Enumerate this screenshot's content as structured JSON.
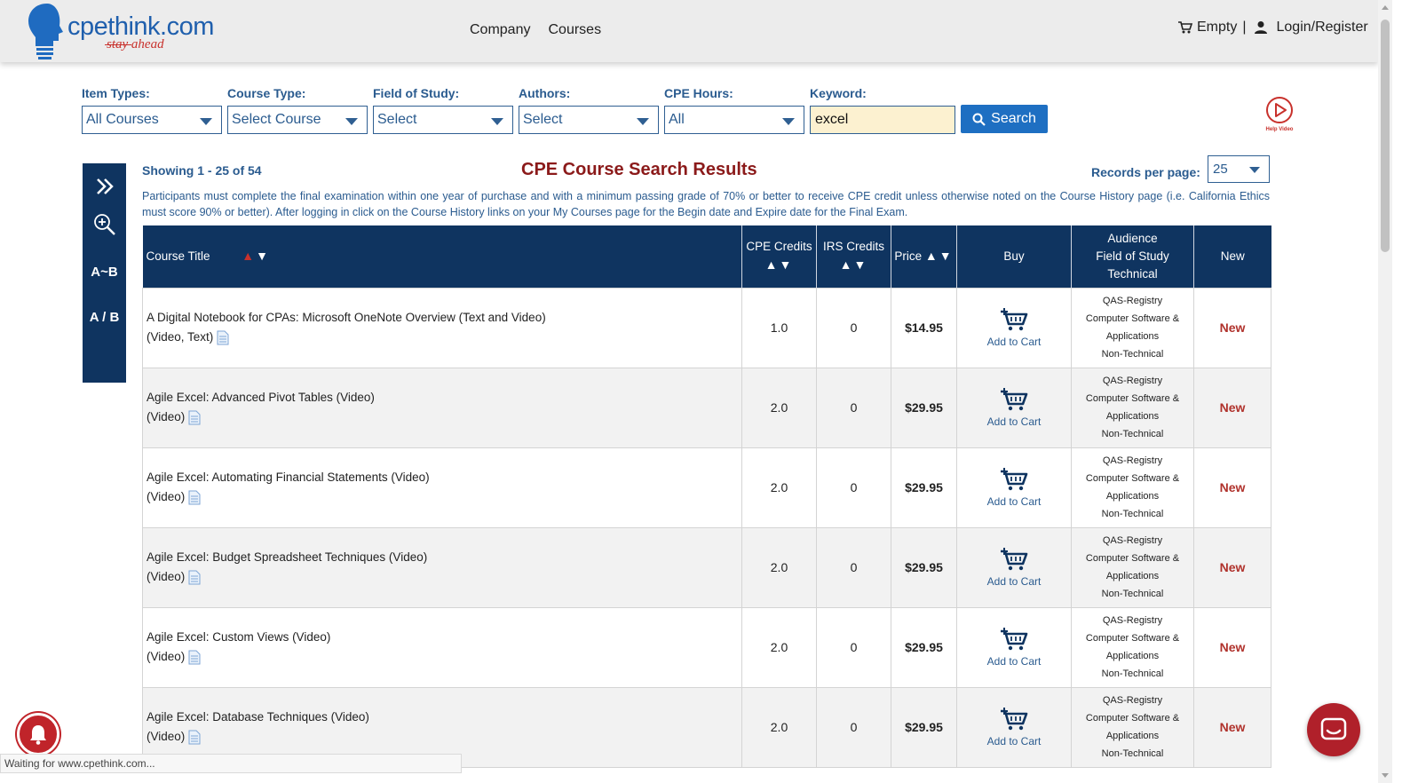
{
  "header": {
    "logo_text": "cpethink.com",
    "logo_tagline": "stay ahead",
    "nav": [
      "Company",
      "Courses"
    ],
    "cart_label": "Empty",
    "separator": "|",
    "login_label": "Login/Register"
  },
  "filters": {
    "item_types": {
      "label": "Item Types:",
      "value": "All Courses"
    },
    "course_type": {
      "label": "Course Type:",
      "value": "Select Course"
    },
    "field_of_study": {
      "label": "Field of Study:",
      "value": "Select"
    },
    "authors": {
      "label": "Authors:",
      "value": "Select"
    },
    "cpe_hours": {
      "label": "CPE Hours:",
      "value": "All"
    },
    "keyword": {
      "label": "Keyword:",
      "value": "excel"
    },
    "search_label": "Search",
    "help_video_label": "Help Video"
  },
  "sidebar": {
    "sort_az": "A~B",
    "sort_ab": "A / B"
  },
  "results": {
    "showing": "Showing 1 - 25 of 54",
    "title": "CPE Course Search Results",
    "records_per_page_label": "Records per page:",
    "records_per_page_value": "25",
    "notice": "Participants must complete the final examination within one year of purchase and with a minimum passing grade of 70% or better to receive CPE credit unless otherwise noted on the Course History page (i.e. California Ethics must score 90% or better). After logging in click on the Course History links on your My Courses page for the Begin date and Expire date for the Final Exam.",
    "columns": {
      "title": "Course Title",
      "cpe_credits": "CPE Credits",
      "irs_credits": "IRS Credits",
      "price": "Price",
      "buy": "Buy",
      "audience_1": "Audience",
      "audience_2": "Field of Study",
      "audience_3": "Technical",
      "new": "New"
    },
    "rows": [
      {
        "title": "A Digital Notebook for CPAs: Microsoft OneNote Overview (Text and Video)",
        "format": "(Video, Text)",
        "cpe": "1.0",
        "irs": "0",
        "price": "$14.95",
        "buy": "Add to Cart",
        "aud1": "QAS-Registry",
        "aud2": "Computer Software &",
        "aud3": "Applications",
        "aud4": "Non-Technical",
        "new": "New"
      },
      {
        "title": "Agile Excel: Advanced Pivot Tables (Video)",
        "format": "(Video)",
        "cpe": "2.0",
        "irs": "0",
        "price": "$29.95",
        "buy": "Add to Cart",
        "aud1": "QAS-Registry",
        "aud2": "Computer Software &",
        "aud3": "Applications",
        "aud4": "Non-Technical",
        "new": "New"
      },
      {
        "title": "Agile Excel: Automating Financial Statements (Video)",
        "format": "(Video)",
        "cpe": "2.0",
        "irs": "0",
        "price": "$29.95",
        "buy": "Add to Cart",
        "aud1": "QAS-Registry",
        "aud2": "Computer Software &",
        "aud3": "Applications",
        "aud4": "Non-Technical",
        "new": "New"
      },
      {
        "title": "Agile Excel: Budget Spreadsheet Techniques (Video)",
        "format": "(Video)",
        "cpe": "2.0",
        "irs": "0",
        "price": "$29.95",
        "buy": "Add to Cart",
        "aud1": "QAS-Registry",
        "aud2": "Computer Software &",
        "aud3": "Applications",
        "aud4": "Non-Technical",
        "new": "New"
      },
      {
        "title": "Agile Excel: Custom Views (Video)",
        "format": "(Video)",
        "cpe": "2.0",
        "irs": "0",
        "price": "$29.95",
        "buy": "Add to Cart",
        "aud1": "QAS-Registry",
        "aud2": "Computer Software &",
        "aud3": "Applications",
        "aud4": "Non-Technical",
        "new": "New"
      },
      {
        "title": "Agile Excel: Database Techniques (Video)",
        "format": "(Video)",
        "cpe": "2.0",
        "irs": "0",
        "price": "$29.95",
        "buy": "Add to Cart",
        "aud1": "QAS-Registry",
        "aud2": "Computer Software &",
        "aud3": "Applications",
        "aud4": "Non-Technical",
        "new": "New"
      }
    ]
  },
  "status_bar": "Waiting for www.cpethink.com...",
  "colors": {
    "navy": "#0f3460",
    "brand_blue": "#1f5fad",
    "accent_red": "#c8312c",
    "search_button": "#1e6fc2",
    "keyword_bg": "#fcf1d0"
  }
}
